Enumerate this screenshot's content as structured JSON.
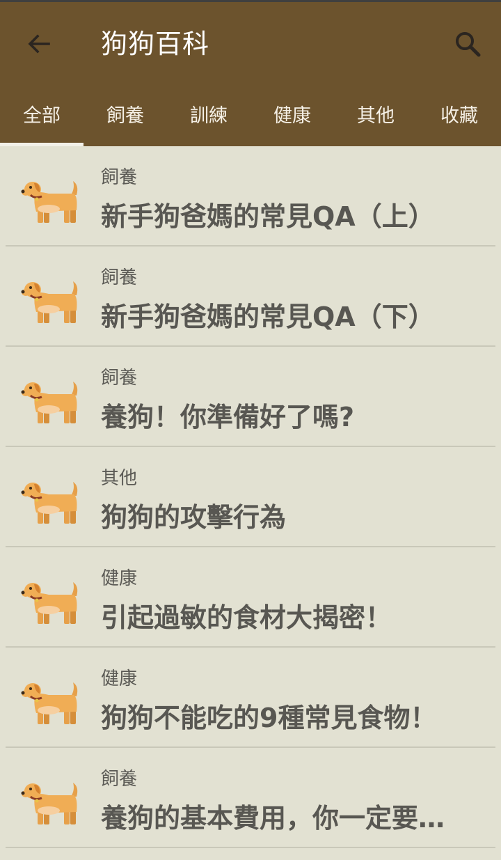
{
  "appbar": {
    "title": "狗狗百科",
    "back_icon": "arrow-left-icon",
    "search_icon": "search-icon"
  },
  "tabs": [
    {
      "label": "全部",
      "active": true
    },
    {
      "label": "飼養",
      "active": false
    },
    {
      "label": "訓練",
      "active": false
    },
    {
      "label": "健康",
      "active": false
    },
    {
      "label": "其他",
      "active": false
    },
    {
      "label": "收藏",
      "active": false
    }
  ],
  "articles": [
    {
      "category": "飼養",
      "title": "新手狗爸媽的常見QA（上）",
      "icon": "dog-icon"
    },
    {
      "category": "飼養",
      "title": "新手狗爸媽的常見QA（下）",
      "icon": "dog-icon"
    },
    {
      "category": "飼養",
      "title": "養狗！你準備好了嗎?",
      "icon": "dog-icon"
    },
    {
      "category": "其他",
      "title": "狗狗的攻擊行為",
      "icon": "dog-icon"
    },
    {
      "category": "健康",
      "title": "引起過敏的食材大揭密！",
      "icon": "dog-icon"
    },
    {
      "category": "健康",
      "title": "狗狗不能吃的9種常見食物！",
      "icon": "dog-icon"
    },
    {
      "category": "飼養",
      "title": "養狗的基本費用，你一定要…",
      "icon": "dog-icon"
    }
  ],
  "colors": {
    "appbar": "#6c532d",
    "background": "#e2e1d2",
    "text": "#585752"
  }
}
